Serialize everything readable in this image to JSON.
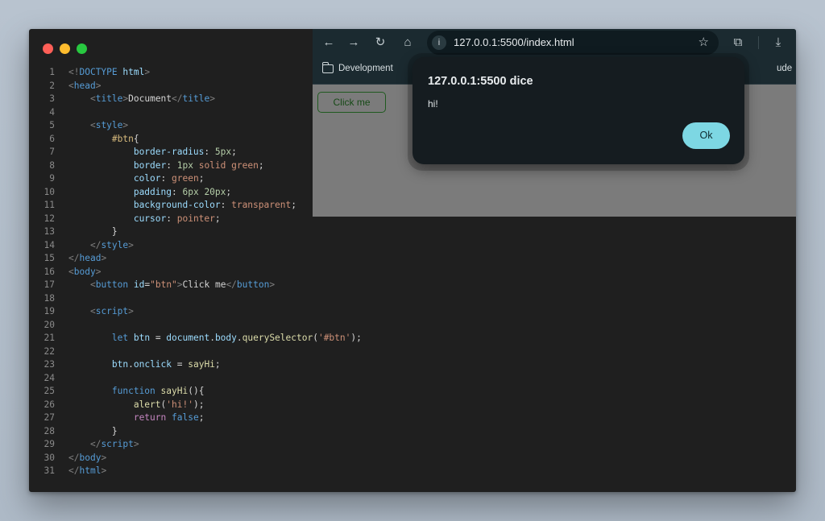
{
  "browser": {
    "url": "127.0.0.1:5500/index.html",
    "bookmark_folder": "Development",
    "bookmark_truncated": "ude",
    "page_button_label": "Click me"
  },
  "alert": {
    "title": "127.0.0.1:5500 dice",
    "message": "hi!",
    "ok_label": "Ok"
  },
  "editor": {
    "lines": [
      [
        [
          "t-br",
          "<!"
        ],
        [
          "t-tag",
          "DOCTYPE"
        ],
        [
          "t-plain",
          " "
        ],
        [
          "t-attr",
          "html"
        ],
        [
          "t-br",
          ">"
        ]
      ],
      [
        [
          "t-br",
          "<"
        ],
        [
          "t-tag",
          "head"
        ],
        [
          "t-br",
          ">"
        ]
      ],
      [
        [
          "t-plain",
          "    "
        ],
        [
          "t-br",
          "<"
        ],
        [
          "t-tag",
          "title"
        ],
        [
          "t-br",
          ">"
        ],
        [
          "t-plain",
          "Document"
        ],
        [
          "t-br",
          "</"
        ],
        [
          "t-tag",
          "title"
        ],
        [
          "t-br",
          ">"
        ]
      ],
      [],
      [
        [
          "t-plain",
          "    "
        ],
        [
          "t-br",
          "<"
        ],
        [
          "t-tag",
          "style"
        ],
        [
          "t-br",
          ">"
        ]
      ],
      [
        [
          "t-plain",
          "        "
        ],
        [
          "t-sel",
          "#btn"
        ],
        [
          "t-plain",
          "{"
        ]
      ],
      [
        [
          "t-plain",
          "            "
        ],
        [
          "t-prop",
          "border-radius"
        ],
        [
          "t-plain",
          ": "
        ],
        [
          "t-num",
          "5px"
        ],
        [
          "t-plain",
          ";"
        ]
      ],
      [
        [
          "t-plain",
          "            "
        ],
        [
          "t-prop",
          "border"
        ],
        [
          "t-plain",
          ": "
        ],
        [
          "t-num",
          "1px"
        ],
        [
          "t-plain",
          " "
        ],
        [
          "t-str",
          "solid"
        ],
        [
          "t-plain",
          " "
        ],
        [
          "t-str",
          "green"
        ],
        [
          "t-plain",
          ";"
        ]
      ],
      [
        [
          "t-plain",
          "            "
        ],
        [
          "t-prop",
          "color"
        ],
        [
          "t-plain",
          ": "
        ],
        [
          "t-str",
          "green"
        ],
        [
          "t-plain",
          ";"
        ]
      ],
      [
        [
          "t-plain",
          "            "
        ],
        [
          "t-prop",
          "padding"
        ],
        [
          "t-plain",
          ": "
        ],
        [
          "t-num",
          "6px"
        ],
        [
          "t-plain",
          " "
        ],
        [
          "t-num",
          "20px"
        ],
        [
          "t-plain",
          ";"
        ]
      ],
      [
        [
          "t-plain",
          "            "
        ],
        [
          "t-prop",
          "background-color"
        ],
        [
          "t-plain",
          ": "
        ],
        [
          "t-str",
          "transparent"
        ],
        [
          "t-plain",
          ";"
        ]
      ],
      [
        [
          "t-plain",
          "            "
        ],
        [
          "t-prop",
          "cursor"
        ],
        [
          "t-plain",
          ": "
        ],
        [
          "t-str",
          "pointer"
        ],
        [
          "t-plain",
          ";"
        ]
      ],
      [
        [
          "t-plain",
          "        }"
        ]
      ],
      [
        [
          "t-plain",
          "    "
        ],
        [
          "t-br",
          "</"
        ],
        [
          "t-tag",
          "style"
        ],
        [
          "t-br",
          ">"
        ]
      ],
      [
        [
          "t-br",
          "</"
        ],
        [
          "t-tag",
          "head"
        ],
        [
          "t-br",
          ">"
        ]
      ],
      [
        [
          "t-br",
          "<"
        ],
        [
          "t-tag",
          "body"
        ],
        [
          "t-br",
          ">"
        ]
      ],
      [
        [
          "t-plain",
          "    "
        ],
        [
          "t-br",
          "<"
        ],
        [
          "t-tag",
          "button"
        ],
        [
          "t-plain",
          " "
        ],
        [
          "t-attr",
          "id"
        ],
        [
          "t-plain",
          "="
        ],
        [
          "t-str",
          "\"btn\""
        ],
        [
          "t-br",
          ">"
        ],
        [
          "t-plain",
          "Click me"
        ],
        [
          "t-br",
          "</"
        ],
        [
          "t-tag",
          "button"
        ],
        [
          "t-br",
          ">"
        ]
      ],
      [],
      [
        [
          "t-plain",
          "    "
        ],
        [
          "t-br",
          "<"
        ],
        [
          "t-tag",
          "script"
        ],
        [
          "t-br",
          ">"
        ]
      ],
      [],
      [
        [
          "t-plain",
          "        "
        ],
        [
          "t-kw",
          "let"
        ],
        [
          "t-plain",
          " "
        ],
        [
          "t-var",
          "btn"
        ],
        [
          "t-plain",
          " = "
        ],
        [
          "t-var",
          "document"
        ],
        [
          "t-plain",
          "."
        ],
        [
          "t-var",
          "body"
        ],
        [
          "t-plain",
          "."
        ],
        [
          "t-fn",
          "querySelector"
        ],
        [
          "t-plain",
          "("
        ],
        [
          "t-str",
          "'#btn'"
        ],
        [
          "t-plain",
          ");"
        ]
      ],
      [],
      [
        [
          "t-plain",
          "        "
        ],
        [
          "t-var",
          "btn"
        ],
        [
          "t-plain",
          "."
        ],
        [
          "t-var",
          "onclick"
        ],
        [
          "t-plain",
          " = "
        ],
        [
          "t-fn",
          "sayHi"
        ],
        [
          "t-plain",
          ";"
        ]
      ],
      [],
      [
        [
          "t-plain",
          "        "
        ],
        [
          "t-kw",
          "function"
        ],
        [
          "t-plain",
          " "
        ],
        [
          "t-fn",
          "sayHi"
        ],
        [
          "t-plain",
          "(){"
        ]
      ],
      [
        [
          "t-plain",
          "            "
        ],
        [
          "t-fn",
          "alert"
        ],
        [
          "t-plain",
          "("
        ],
        [
          "t-str",
          "'hi!'"
        ],
        [
          "t-plain",
          ");"
        ]
      ],
      [
        [
          "t-plain",
          "            "
        ],
        [
          "t-ctl",
          "return"
        ],
        [
          "t-plain",
          " "
        ],
        [
          "t-kw",
          "false"
        ],
        [
          "t-plain",
          ";"
        ]
      ],
      [
        [
          "t-plain",
          "        }"
        ]
      ],
      [
        [
          "t-plain",
          "    "
        ],
        [
          "t-br",
          "</"
        ],
        [
          "t-tag",
          "script"
        ],
        [
          "t-br",
          ">"
        ]
      ],
      [
        [
          "t-br",
          "</"
        ],
        [
          "t-tag",
          "body"
        ],
        [
          "t-br",
          ">"
        ]
      ],
      [
        [
          "t-br",
          "</"
        ],
        [
          "t-tag",
          "html"
        ],
        [
          "t-br",
          ">"
        ]
      ]
    ]
  }
}
